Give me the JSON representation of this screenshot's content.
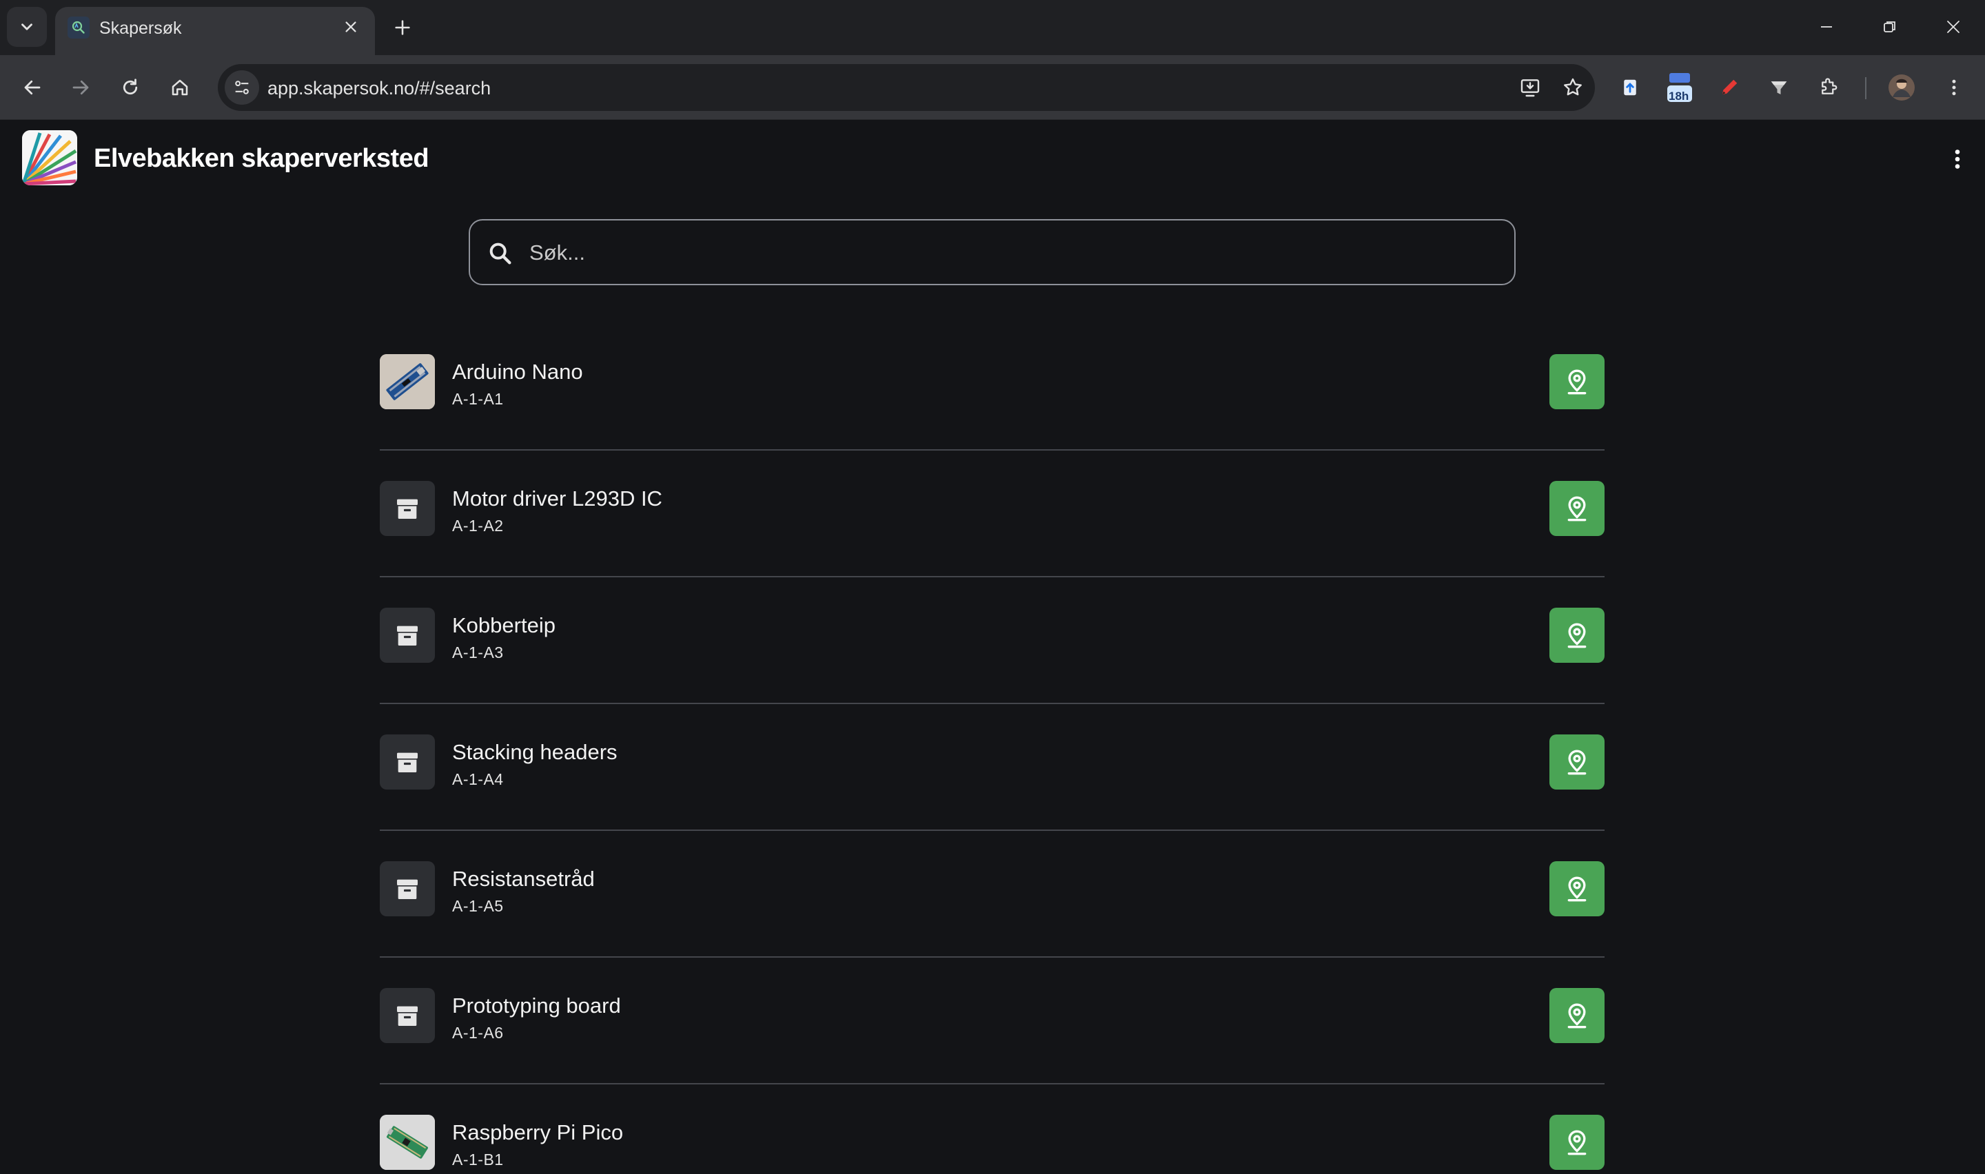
{
  "browser": {
    "tab_title": "Skapersøk",
    "url": "app.skapersok.no/#/search",
    "extension_badge": "18h"
  },
  "app": {
    "title": "Elvebakken skaperverksted"
  },
  "search": {
    "placeholder": "Søk...",
    "value": ""
  },
  "items": [
    {
      "name": "Arduino Nano",
      "code": "A-1-A1",
      "thumbnail": "arduino-nano-photo"
    },
    {
      "name": "Motor driver L293D IC",
      "code": "A-1-A2",
      "thumbnail": "archive-box-icon"
    },
    {
      "name": "Kobberteip",
      "code": "A-1-A3",
      "thumbnail": "archive-box-icon"
    },
    {
      "name": "Stacking headers",
      "code": "A-1-A4",
      "thumbnail": "archive-box-icon"
    },
    {
      "name": "Resistansetråd",
      "code": "A-1-A5",
      "thumbnail": "archive-box-icon"
    },
    {
      "name": "Prototyping board",
      "code": "A-1-A6",
      "thumbnail": "archive-box-icon"
    },
    {
      "name": "Raspberry Pi Pico",
      "code": "A-1-B1",
      "thumbnail": "raspberry-pi-pico-photo"
    }
  ],
  "colors": {
    "background": "#131417",
    "location_button": "#4aa455",
    "divider": "#44464c",
    "chrome_toolbar": "#35363a"
  }
}
